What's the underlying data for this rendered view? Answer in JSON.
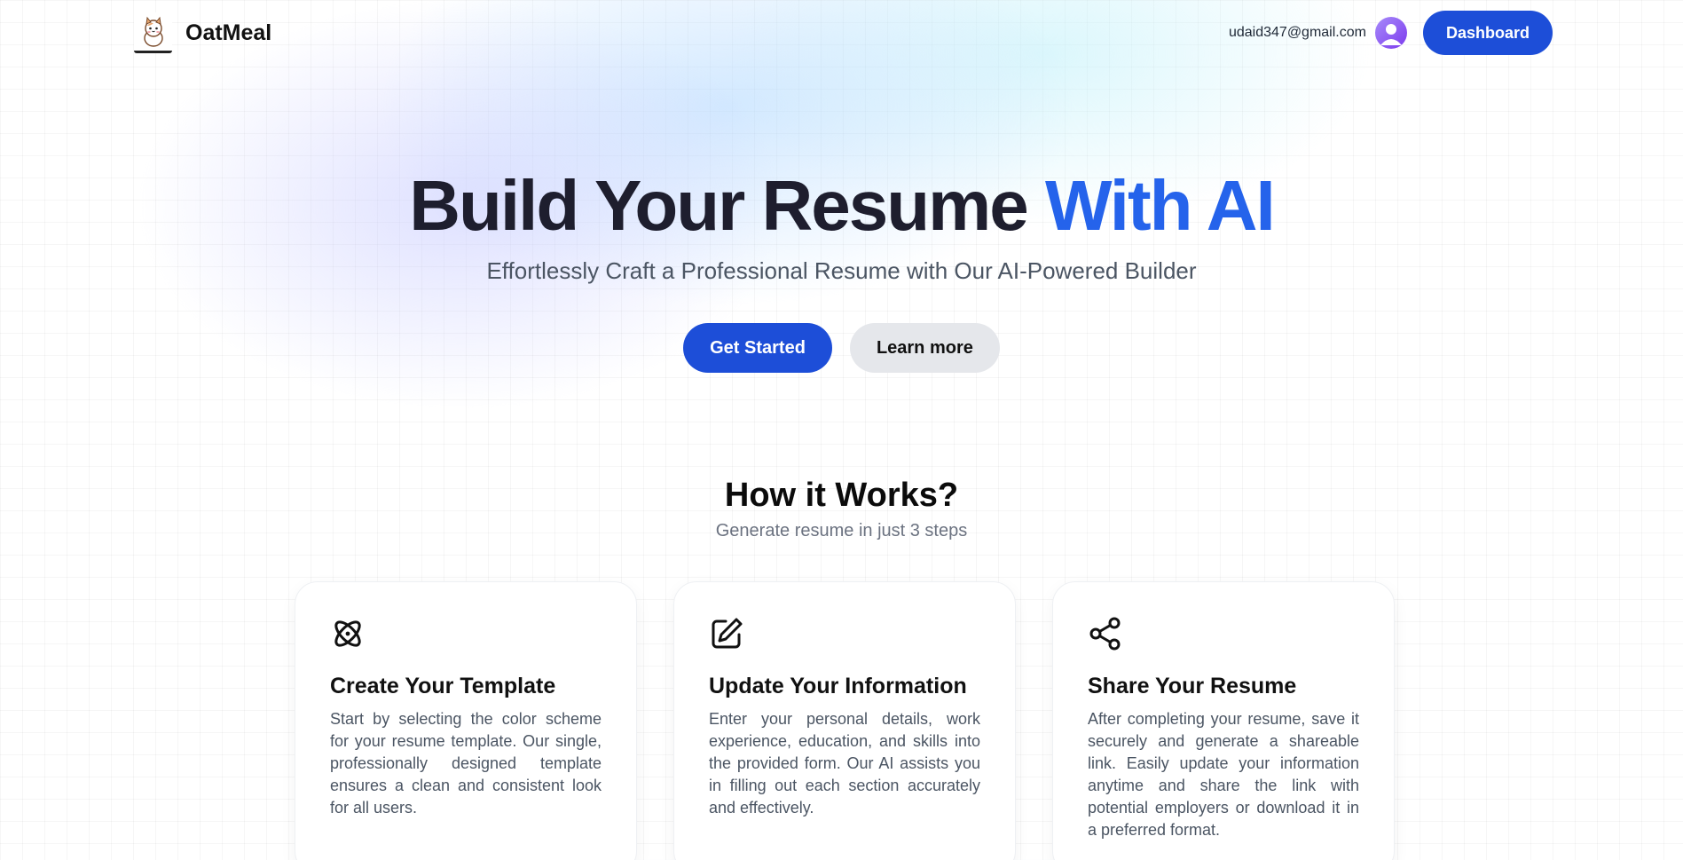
{
  "header": {
    "brand_name": "OatMeal",
    "logo_icon": "cat-logo-icon",
    "email": "udaid347@gmail.com",
    "avatar_icon": "user-avatar-icon",
    "dashboard_label": "Dashboard"
  },
  "hero": {
    "title_main": "Build Your Resume",
    "title_accent": "With AI",
    "subtitle": "Effortlessly Craft a Professional Resume with Our AI-Powered Builder",
    "primary_label": "Get Started",
    "secondary_label": "Learn more"
  },
  "how": {
    "title": "How it Works?",
    "subtitle": "Generate resume in just 3 steps",
    "cards": [
      {
        "icon": "atom-icon",
        "title": "Create Your Template",
        "text": "Start by selecting the color scheme for your resume template. Our single, professionally designed template ensures a clean and consistent look for all users."
      },
      {
        "icon": "edit-icon",
        "title": "Update Your Information",
        "text": "Enter your personal details, work experience, education, and skills into the provided form. Our AI assists you in filling out each section accurately and effectively."
      },
      {
        "icon": "share-icon",
        "title": "Share Your Resume",
        "text": "After completing your resume, save it securely and generate a shareable link. Easily update your information anytime and share the link with potential employers or download it in a preferred format."
      }
    ]
  },
  "colors": {
    "primary": "#1d4ed8",
    "accent_text": "#2563eb",
    "secondary_button": "#e5e7eb",
    "avatar": "#8b5cf6"
  }
}
